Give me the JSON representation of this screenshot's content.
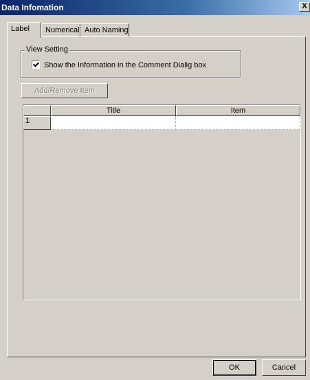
{
  "window": {
    "title": "Data Infomation",
    "close_label": "X"
  },
  "tabs": [
    {
      "label": "Label",
      "active": true
    },
    {
      "label": "Numerical",
      "active": false
    },
    {
      "label": "Auto Naming",
      "active": false
    }
  ],
  "view_setting": {
    "legend": "View Setting",
    "checkbox_label": "Show the Information in the Comment Dialig box",
    "checked": true
  },
  "add_remove_button": "Add/Remove Item",
  "grid": {
    "columns": [
      "Title",
      "Item"
    ],
    "rows": [
      {
        "number": "1",
        "title": "",
        "item": ""
      }
    ]
  },
  "buttons": {
    "ok": "OK",
    "cancel": "Cancel"
  }
}
